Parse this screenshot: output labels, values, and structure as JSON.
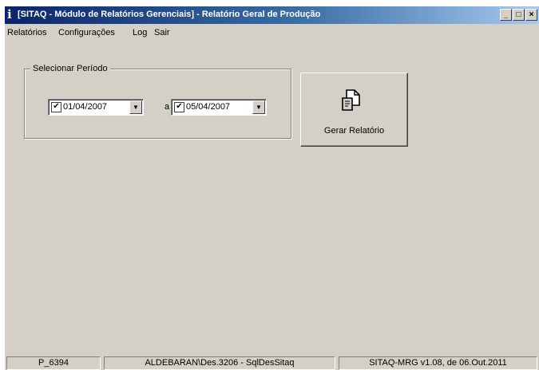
{
  "window": {
    "title": "[SITAQ - Módulo de Relatórios Gerenciais] - Relatório Geral de Produção",
    "app_icon": "info-icon",
    "minimize_glyph": "_",
    "maximize_glyph": "□",
    "close_glyph": "×"
  },
  "menu": {
    "items": [
      {
        "label": "Relatórios"
      },
      {
        "label": "Configurações"
      },
      {
        "label": "Log"
      },
      {
        "label": "Sair"
      }
    ]
  },
  "period": {
    "legend": "Selecionar Período",
    "start": {
      "checked": true,
      "value": "01/04/2007"
    },
    "separator": "a",
    "end": {
      "checked": true,
      "value": "05/04/2007"
    }
  },
  "actions": {
    "generate_label": "Gerar Relatório",
    "generate_icon": "report-document-icon"
  },
  "status": {
    "panels": [
      "P_6394",
      "ALDEBARAN\\Des.3206 - SqlDesSitaq",
      "SITAQ-MRG v1.08, de 06.Out.2011"
    ]
  },
  "colors": {
    "face": "#d4d0c8",
    "titlebar_start": "#0a246a",
    "titlebar_end": "#a6caf0"
  }
}
